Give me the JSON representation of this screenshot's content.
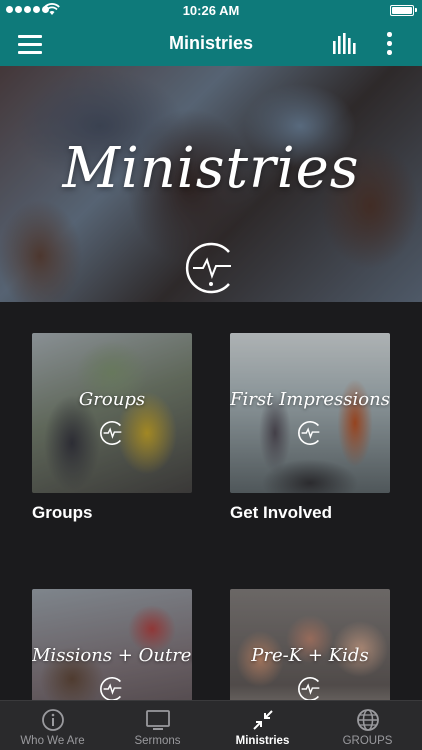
{
  "status_bar": {
    "time": "10:26 AM"
  },
  "nav": {
    "title": "Ministries"
  },
  "hero": {
    "title": "Ministries"
  },
  "tiles": [
    {
      "script": "Groups",
      "label": "Groups"
    },
    {
      "script": "First Impressions",
      "label": "Get Involved"
    },
    {
      "script": "Missions + Outreach",
      "label": ""
    },
    {
      "script": "Pre-K + Kids",
      "label": ""
    }
  ],
  "tabs": [
    {
      "label": "Who We Are",
      "icon": "info-icon"
    },
    {
      "label": "Sermons",
      "icon": "tv-icon"
    },
    {
      "label": "Ministries",
      "icon": "collapse-arrows-icon",
      "active": true
    },
    {
      "label": "GROUPS",
      "icon": "globe-icon"
    }
  ],
  "colors": {
    "nav_bg": "#0e7a7a",
    "page_bg": "#1b1b1d",
    "tabbar_bg": "#2a2a2c",
    "tab_inactive": "#9a9a9e"
  }
}
